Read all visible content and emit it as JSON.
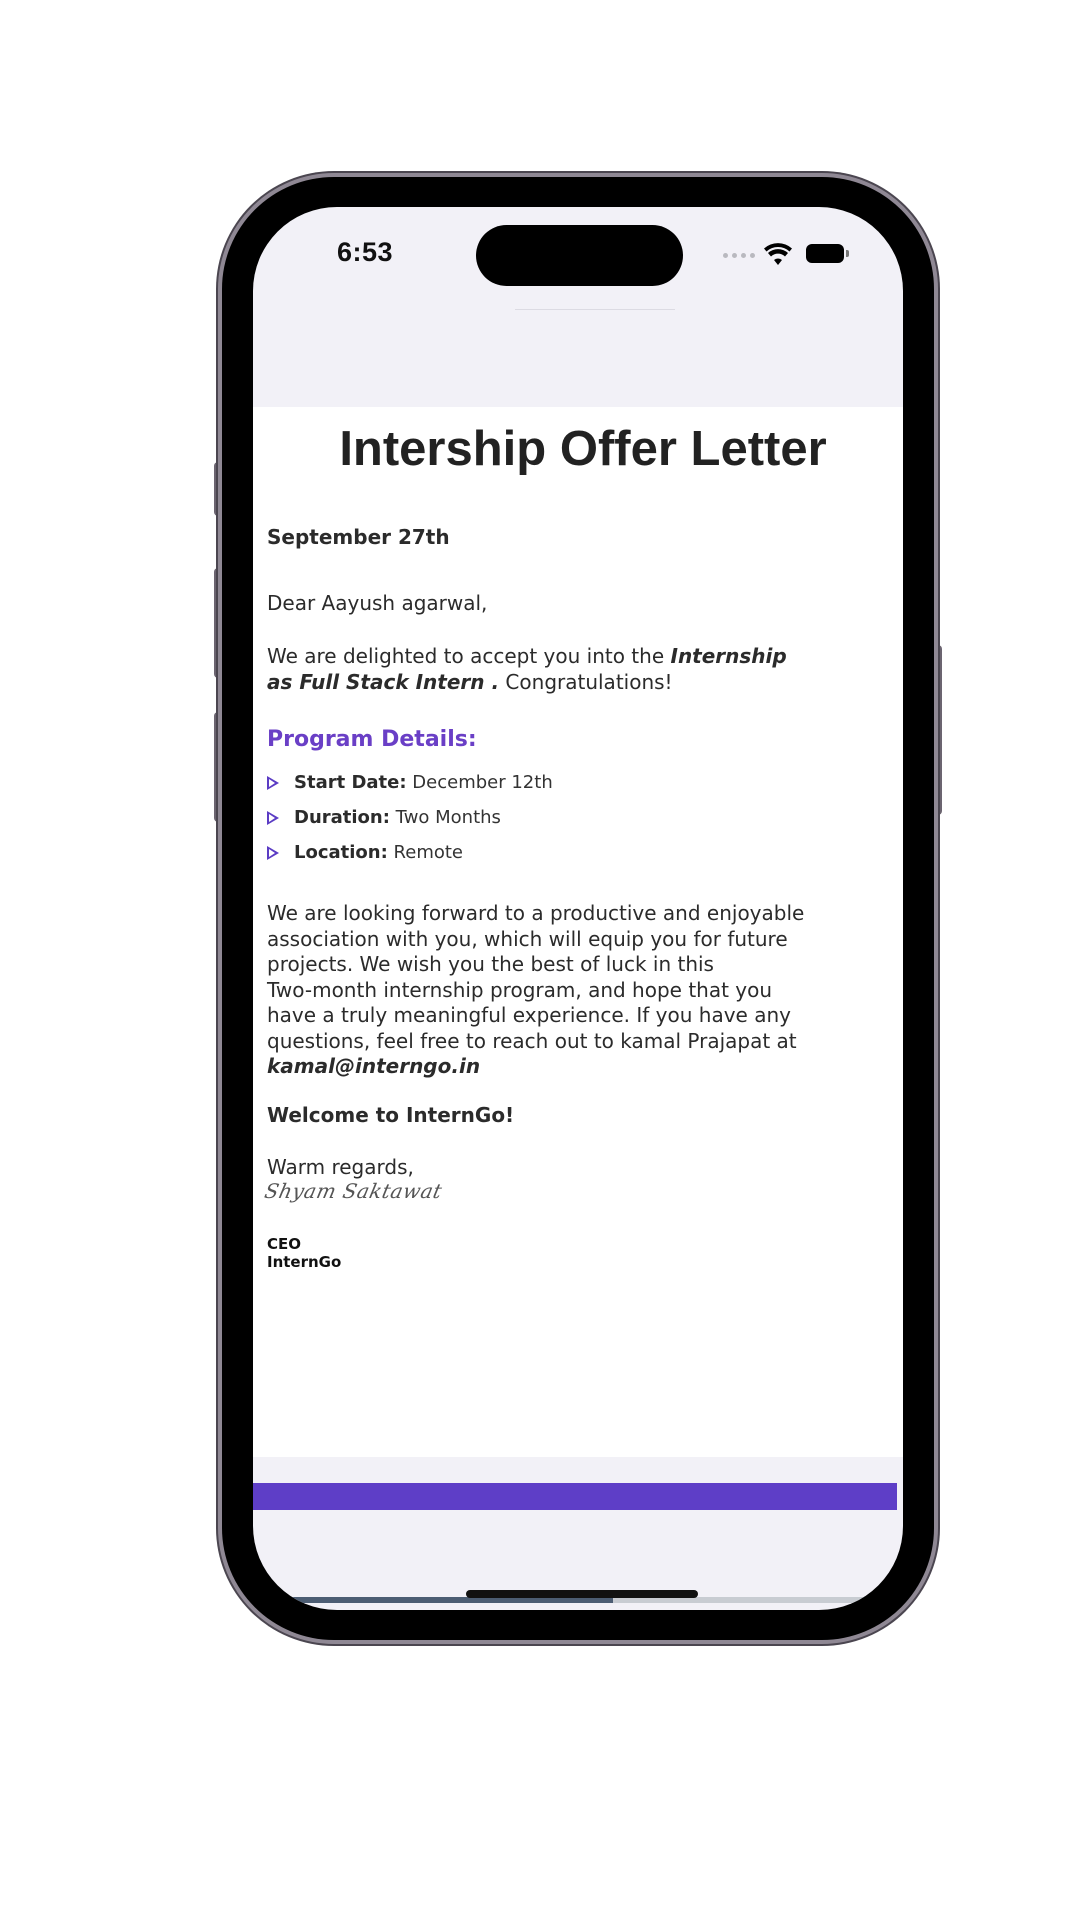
{
  "status_bar": {
    "time": "6:53"
  },
  "letter": {
    "title": "Intership Offer Letter",
    "date": "September 27th",
    "greeting": "Dear Aayush agarwal,",
    "intro_prefix": "We are delighted to accept you into the ",
    "intro_role": "Internship as Full Stack Intern .",
    "intro_suffix": " Congratulations!",
    "section_title": "Program Details:",
    "details": [
      {
        "label": "Start Date:",
        "value": "December 12th"
      },
      {
        "label": "Duration:",
        "value": "Two Months"
      },
      {
        "label": "Location:",
        "value": "Remote"
      }
    ],
    "body": "We are looking forward to a productive and enjoyable\n association with you, which will equip you for future\nprojects. We wish you the best of luck in this\nTwo-month internship program, and hope that you\n have a truly meaningful experience. If you have any\n questions, feel free to reach out to kamal Prajapat at",
    "email": "kamal@interngo.in",
    "welcome": "Welcome to InternGo!",
    "closing": "Warm regards,",
    "signature": "Shyam Saktawat",
    "signer_title": "CEO",
    "signer_company": "InternGo"
  },
  "colors": {
    "accent": "#6a3fc6",
    "footer_bar": "#5e3ec7"
  },
  "icons": {
    "bullet": "triangle-outline-icon",
    "wifi": "wifi-icon",
    "battery": "battery-icon",
    "signal": "cellular-signal-icon"
  }
}
